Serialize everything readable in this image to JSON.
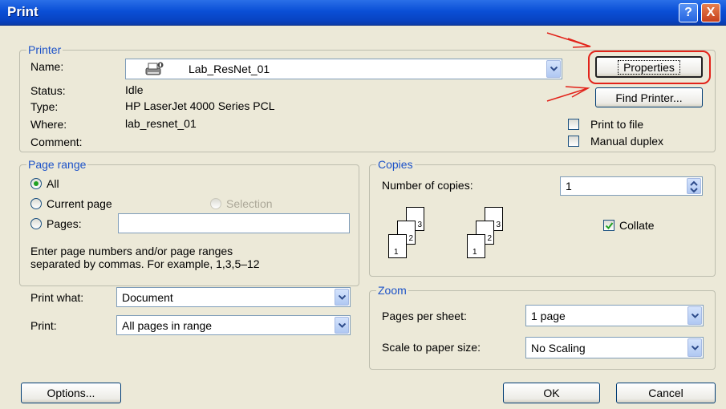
{
  "window": {
    "title": "Print",
    "help_label": "?",
    "close_label": "X"
  },
  "printer": {
    "group_label": "Printer",
    "name_label": "Name:",
    "name_value": "Lab_ResNet_01",
    "status_label": "Status:",
    "status_value": "Idle",
    "type_label": "Type:",
    "type_value": "HP LaserJet 4000 Series PCL",
    "where_label": "Where:",
    "where_value": "lab_resnet_01",
    "comment_label": "Comment:",
    "comment_value": "",
    "properties_label": "Properties",
    "find_printer_label": "Find Printer...",
    "print_to_file_label": "Print to file",
    "print_to_file_checked": false,
    "manual_duplex_label": "Manual duplex",
    "manual_duplex_checked": false
  },
  "page_range": {
    "group_label": "Page range",
    "all_label": "All",
    "current_page_label": "Current page",
    "selection_label": "Selection",
    "pages_label": "Pages:",
    "pages_value": "",
    "selected": "All",
    "help_line1": "Enter page numbers and/or page ranges",
    "help_line2": "separated by commas.  For example, 1,3,5–12"
  },
  "copies": {
    "group_label": "Copies",
    "number_label": "Number of copies:",
    "number_value": "1",
    "collate_label": "Collate",
    "collate_checked": true,
    "page_labels": [
      "1",
      "2",
      "3"
    ]
  },
  "print_options": {
    "print_what_label": "Print what:",
    "print_what_value": "Document",
    "print_label": "Print:",
    "print_value": "All pages in range"
  },
  "zoom": {
    "group_label": "Zoom",
    "pages_per_sheet_label": "Pages per sheet:",
    "pages_per_sheet_value": "1 page",
    "scale_label": "Scale to paper size:",
    "scale_value": "No Scaling"
  },
  "footer": {
    "options_label": "Options...",
    "ok_label": "OK",
    "cancel_label": "Cancel"
  },
  "colors": {
    "titlebar": "#0a4fd6",
    "group_label": "#1c52c8",
    "annotation": "#e2231a",
    "dialog_bg": "#ece9d8"
  },
  "icons": {
    "printer": "printer-icon",
    "dropdown": "chevron-down-icon",
    "spinner": "spin-updown-icon",
    "checkmark": "checkmark-icon"
  }
}
